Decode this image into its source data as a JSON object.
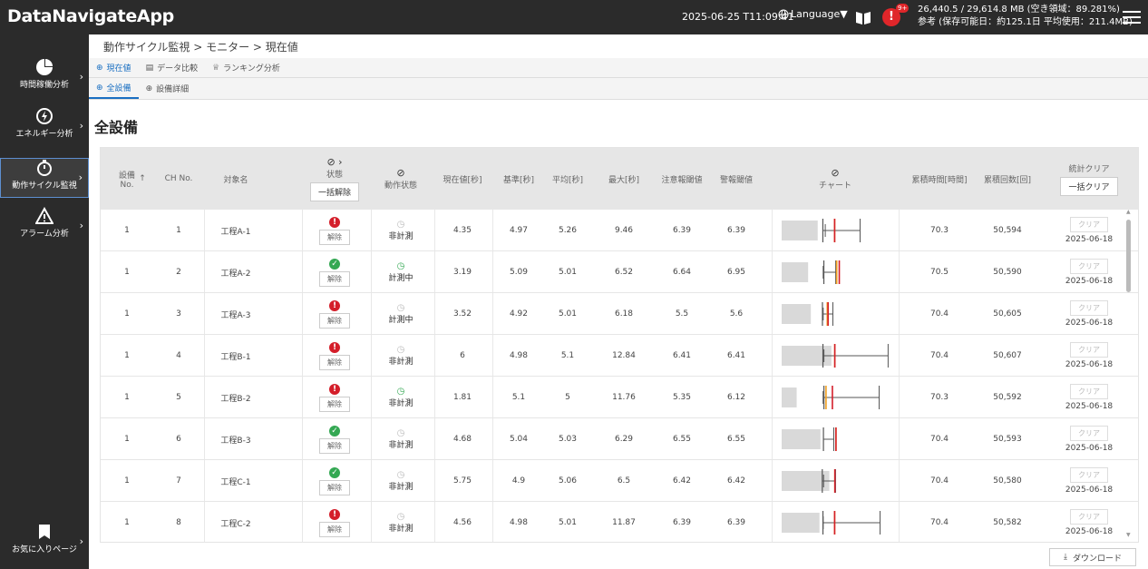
{
  "app": {
    "title": "DataNavigateApp",
    "datetime": "2025-06-25 T11:09:41",
    "language_label": "Language▼",
    "alert_count": "9+",
    "storage_line1": "26,440.5 / 29,614.8 MB (空き領域：89.281%)",
    "storage_line2": "参考 (保存可能日：約125.1日 平均使用：211.4MB)"
  },
  "sidebar": {
    "items": [
      {
        "label": "時間稼働分析",
        "icon": "pie-chart-icon"
      },
      {
        "label": "エネルギー分析",
        "icon": "energy-icon"
      },
      {
        "label": "動作サイクル監視",
        "icon": "timer-icon"
      },
      {
        "label": "アラーム分析",
        "icon": "warning-icon"
      },
      {
        "label": "お気に入りページ",
        "icon": "bookmark-icon"
      }
    ]
  },
  "breadcrumb": "動作サイクル監視 > モニター > 現在値",
  "tabs1": [
    "現在値",
    "データ比較",
    "ランキング分析"
  ],
  "tabs2": [
    "全設備",
    "設備詳細"
  ],
  "page_title": "全設備",
  "headers": {
    "equip_no": "設備\nNo.",
    "ch_no": "CH No.",
    "target": "対象名",
    "status": "状態",
    "bulk_release": "一括解除",
    "op_state": "動作状態",
    "current": "現在値[秒]",
    "base": "基準[秒]",
    "avg": "平均[秒]",
    "max": "最大[秒]",
    "warn": "注意報閾値",
    "alarm": "警報閾値",
    "chart": "チャート",
    "cum_time": "累積時間[時間]",
    "cum_count": "累積回数[回]",
    "stat_clear": "統計クリア",
    "bulk_clear": "一括クリア"
  },
  "rows": [
    {
      "equip": "1",
      "ch": "1",
      "name": "工程A-1",
      "status": "ng",
      "release": "解除",
      "op": "非計測",
      "op_on": false,
      "current": "4.35",
      "base": "4.97",
      "avg": "5.26",
      "max": "9.46",
      "warn": "6.39",
      "alarm": "6.39",
      "cum_time": "70.3",
      "cum_count": "50,594",
      "clear": "クリア",
      "clear_date": "2025-06-18"
    },
    {
      "equip": "1",
      "ch": "2",
      "name": "工程A-2",
      "status": "ok",
      "release": "解除",
      "op": "計測中",
      "op_on": true,
      "current": "3.19",
      "base": "5.09",
      "avg": "5.01",
      "max": "6.52",
      "warn": "6.64",
      "alarm": "6.95",
      "cum_time": "70.5",
      "cum_count": "50,590",
      "clear": "クリア",
      "clear_date": "2025-06-18"
    },
    {
      "equip": "1",
      "ch": "3",
      "name": "工程A-3",
      "status": "ng",
      "release": "解除",
      "op": "計測中",
      "op_on": false,
      "current": "3.52",
      "base": "4.92",
      "avg": "5.01",
      "max": "6.18",
      "warn": "5.5",
      "alarm": "5.6",
      "cum_time": "70.4",
      "cum_count": "50,605",
      "clear": "クリア",
      "clear_date": "2025-06-18"
    },
    {
      "equip": "1",
      "ch": "4",
      "name": "工程B-1",
      "status": "ng",
      "release": "解除",
      "op": "非計測",
      "op_on": false,
      "current": "6",
      "base": "4.98",
      "avg": "5.1",
      "max": "12.84",
      "warn": "6.41",
      "alarm": "6.41",
      "cum_time": "70.4",
      "cum_count": "50,607",
      "clear": "クリア",
      "clear_date": "2025-06-18"
    },
    {
      "equip": "1",
      "ch": "5",
      "name": "工程B-2",
      "status": "ng",
      "release": "解除",
      "op": "非計測",
      "op_on": true,
      "current": "1.81",
      "base": "5.1",
      "avg": "5",
      "max": "11.76",
      "warn": "5.35",
      "alarm": "6.12",
      "cum_time": "70.3",
      "cum_count": "50,592",
      "clear": "クリア",
      "clear_date": "2025-06-18"
    },
    {
      "equip": "1",
      "ch": "6",
      "name": "工程B-3",
      "status": "ok",
      "release": "解除",
      "op": "非計測",
      "op_on": false,
      "current": "4.68",
      "base": "5.04",
      "avg": "5.03",
      "max": "6.29",
      "warn": "6.55",
      "alarm": "6.55",
      "cum_time": "70.4",
      "cum_count": "50,593",
      "clear": "クリア",
      "clear_date": "2025-06-18"
    },
    {
      "equip": "1",
      "ch": "7",
      "name": "工程C-1",
      "status": "ok",
      "release": "解除",
      "op": "非計測",
      "op_on": false,
      "current": "5.75",
      "base": "4.9",
      "avg": "5.06",
      "max": "6.5",
      "warn": "6.42",
      "alarm": "6.42",
      "cum_time": "70.4",
      "cum_count": "50,580",
      "clear": "クリア",
      "clear_date": "2025-06-18"
    },
    {
      "equip": "1",
      "ch": "8",
      "name": "工程C-2",
      "status": "ng",
      "release": "解除",
      "op": "非計測",
      "op_on": false,
      "current": "4.56",
      "base": "4.98",
      "avg": "5.01",
      "max": "11.87",
      "warn": "6.39",
      "alarm": "6.39",
      "cum_time": "70.4",
      "cum_count": "50,582",
      "clear": "クリア",
      "clear_date": "2025-06-18"
    }
  ],
  "download_label": "ダウンロード",
  "colors": {
    "bar": "#d9d9d9",
    "warn": "#f0a020",
    "alarm": "#d41e2a",
    "whisker": "#555555",
    "ok": "#34a853",
    "ng": "#d41e2a",
    "accent": "#1a6fc2"
  }
}
